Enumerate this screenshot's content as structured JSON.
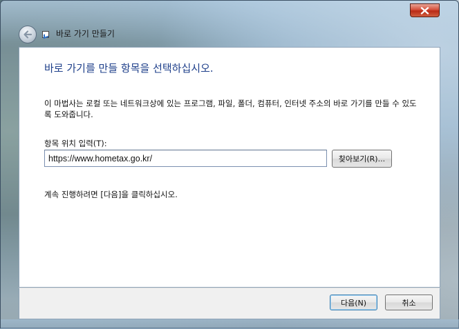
{
  "window": {
    "title": "바로 가기 만들기"
  },
  "content": {
    "heading": "바로 가기를 만들 항목을 선택하십시오.",
    "description": "이 마법사는 로컬 또는 네트워크상에 있는 프로그램, 파일, 폴더, 컴퓨터, 인터넷 주소의 바로 가기를 만들 수 있도록 도와줍니다.",
    "field_label": "항목 위치 입력(T):",
    "location_value": "https://www.hometax.go.kr/",
    "browse_label": "찾아보기(R)...",
    "continue_text": "계속 진행하려면 [다음]을 클릭하십시오."
  },
  "footer": {
    "next_label": "다음(N)",
    "cancel_label": "취소"
  },
  "icons": {
    "close": "close-icon",
    "back": "back-arrow-icon",
    "wizard": "shortcut-wizard-icon"
  },
  "colors": {
    "heading": "#1e3f8a",
    "close_button": "#c8442c",
    "default_button_border": "#3c7fb1"
  }
}
